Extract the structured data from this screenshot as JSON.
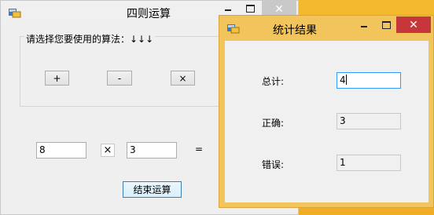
{
  "colors": {
    "desktop": "#f2b631",
    "stats_frame": "#f2c45c",
    "close_active": "#c7363b"
  },
  "main_window": {
    "title": "四则运算",
    "min_icon": "minimize-icon",
    "max_icon": "maximize-icon",
    "close_icon": "close-icon",
    "group_label": "请选择您要使用的算法：↓↓↓",
    "btn_add": "+",
    "btn_sub": "-",
    "btn_mul": "×",
    "operand1": "8",
    "operator": "×",
    "operand2": "3",
    "equals": "=",
    "end_button": "结束运算"
  },
  "stats_window": {
    "title": "统计结果",
    "total_label": "总计:",
    "total_value": "4",
    "correct_label": "正确:",
    "correct_value": "3",
    "wrong_label": "错误:",
    "wrong_value": "1"
  }
}
